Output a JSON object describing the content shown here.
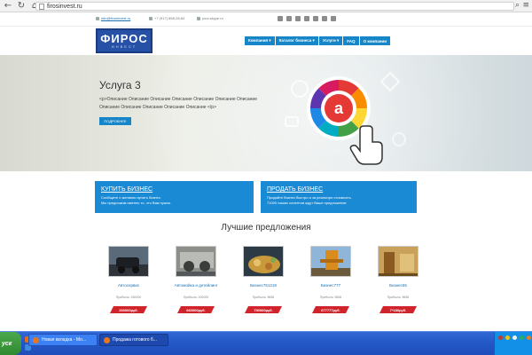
{
  "browser": {
    "back_icon": "back-arrow-icon",
    "reload_icon": "reload-icon",
    "url": "firosinvest.ru"
  },
  "topbar": {
    "email": "info@firosinvest.ru",
    "phone": "+7 (917) 858-28-84",
    "skype": "your.skype.ru",
    "social_icons": [
      "vk-icon",
      "twitter-icon",
      "facebook-icon",
      "youtube-icon",
      "instagram-icon",
      "mail-icon",
      "odnoklassniki-icon"
    ]
  },
  "logo": {
    "main": "ФИРОС",
    "sub": "ИНВЕСТ"
  },
  "nav": [
    {
      "label": "Компания ▾"
    },
    {
      "label": "Каталог бизнеса ▾"
    },
    {
      "label": "Услуги ▾"
    },
    {
      "label": "FAQ"
    },
    {
      "label": "О компании"
    }
  ],
  "hero": {
    "title": "Услуга 3",
    "description": "<p>Описание Описание Описание Описание Описание Описание Описание Описание Описание Описание Описание Описание </p>",
    "button": "ПОДРОБНЕЕ"
  },
  "panels": {
    "buy": {
      "title": "КУПИТЬ БИЗНЕС",
      "line1": "Сообщите о желании купить бизнес.",
      "line2": "Мы предложим именно то, что Вам нужно."
    },
    "sell": {
      "title": "ПРОДАТЬ БИЗНЕС",
      "line1": "Продайте бизнес быстро и за реальную стоимость.",
      "line2": "71000 наших клиентов ждут Ваше предложение"
    }
  },
  "offers": {
    "title": "Лучшие предложения",
    "items": [
      {
        "name": "Автосервис",
        "profit": "Прибыль: 150000",
        "price": "260000руб."
      },
      {
        "name": "Автомойка и детейлинг",
        "profit": "Прибыль: 200000",
        "price": "660000руб."
      },
      {
        "name": "Бизнес751219",
        "profit": "Прибыль: 5656",
        "price": "750000руб."
      },
      {
        "name": "Бизнес777",
        "profit": "Прибыль: 5656",
        "price": "677777руб."
      },
      {
        "name": "Бизнес55",
        "profit": "Прибыль: 5656",
        "price": "7*180руб."
      }
    ]
  },
  "taskbar": {
    "start": "уск",
    "tasks": [
      {
        "label": "Новая вкладка - Мо..."
      },
      {
        "label": "Продажа готового б..."
      }
    ]
  },
  "colors": {
    "brand_blue": "#1686c8",
    "panel_blue": "#1a8ad4",
    "price_red": "#d1232a",
    "logo_blue": "#2651a6"
  }
}
